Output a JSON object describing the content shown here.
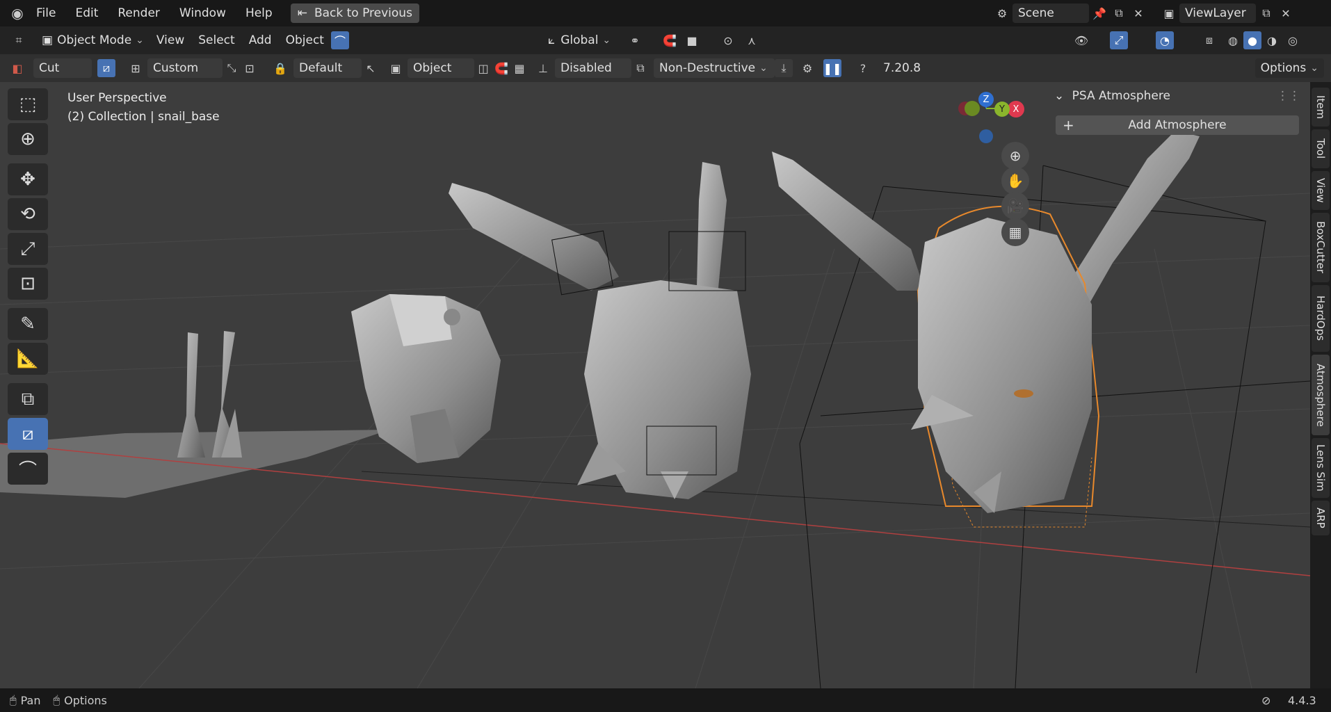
{
  "menu": {
    "file": "File",
    "edit": "Edit",
    "render": "Render",
    "window": "Window",
    "help": "Help",
    "back": "Back to Previous"
  },
  "scene": {
    "name": "Scene",
    "view_layer": "ViewLayer"
  },
  "header": {
    "mode": "Object Mode",
    "view": "View",
    "select": "Select",
    "add": "Add",
    "object": "Object",
    "orientation": "Global"
  },
  "tool_header": {
    "tool": "Cut",
    "shape": "Custom",
    "align": "Default",
    "target": "Object",
    "mirror": "Disabled",
    "mode": "Non-Destructive",
    "version": "7.20.8",
    "options": "Options"
  },
  "viewport": {
    "perspective": "User Perspective",
    "collection": "(2) Collection | snail_base"
  },
  "gizmo": {
    "z": "Z",
    "x": "X",
    "y": "Y"
  },
  "npanel": {
    "title": "PSA Atmosphere",
    "add_button": "Add Atmosphere"
  },
  "tabs": [
    "Item",
    "Tool",
    "View",
    "BoxCutter",
    "HardOps",
    "Atmosphere",
    "Lens Sim",
    "ARP"
  ],
  "status": {
    "pan": "Pan",
    "options": "Options",
    "version": "4.4.3"
  },
  "colors": {
    "accent": "#4772b3",
    "selection": "#e8892c",
    "x_axis": "#e0394f",
    "y_axis": "#8ab52c",
    "z_axis": "#2f6fd0"
  }
}
